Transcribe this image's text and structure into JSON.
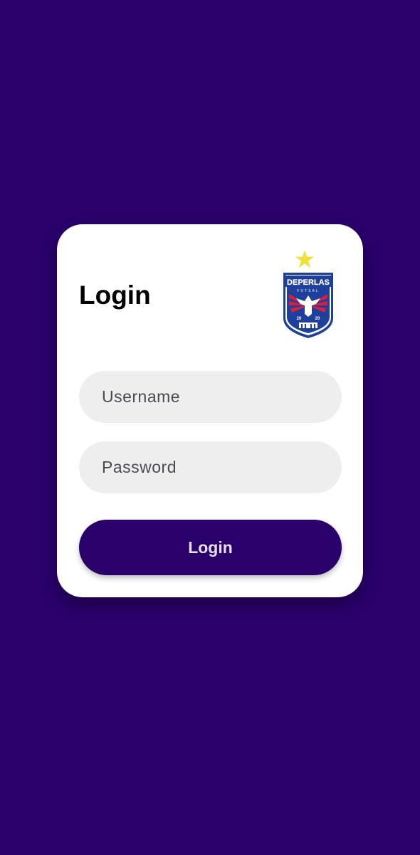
{
  "login_card": {
    "title": "Login",
    "logo": {
      "name": "DEPERLAS",
      "subtitle": "FUTSAL",
      "year_left": "20",
      "year_right": "20"
    },
    "username_field": {
      "value": "",
      "placeholder": "Username"
    },
    "password_field": {
      "value": "",
      "placeholder": "Password"
    },
    "login_button_label": "Login"
  },
  "colors": {
    "background": "#2a006b",
    "card": "#ffffff",
    "field": "#eeeeee",
    "button": "#2a006b",
    "logo_star": "#f2e03a",
    "logo_blue": "#1f3f9c",
    "logo_red": "#d8203a"
  }
}
